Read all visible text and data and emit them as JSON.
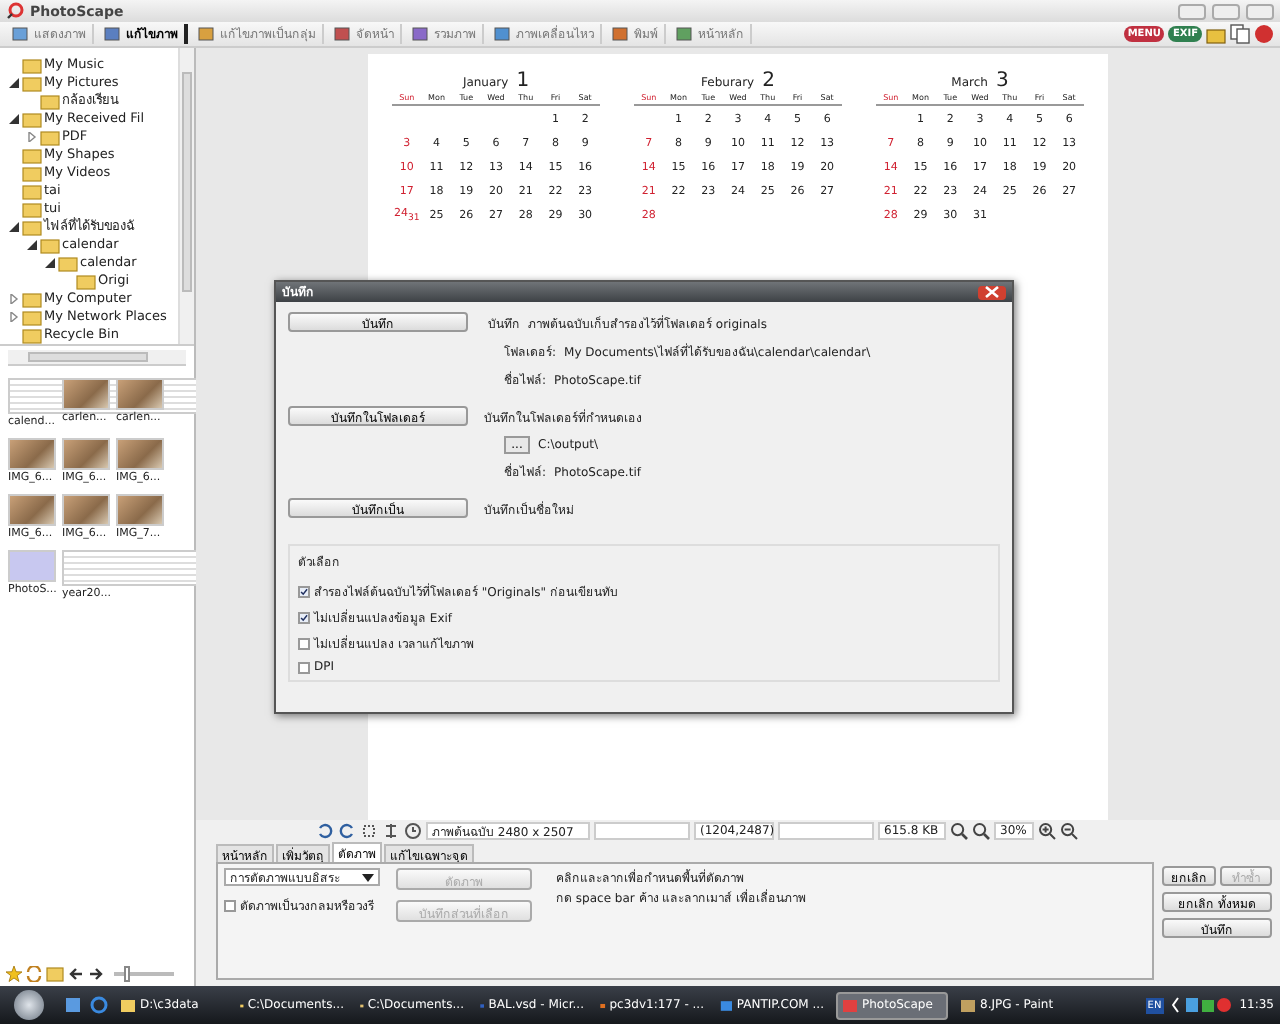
{
  "window": {
    "title": "PhotoScape"
  },
  "main_tabs": [
    {
      "label": "แสดงภาพ",
      "selected": false
    },
    {
      "label": "แก้ไขภาพ",
      "selected": true
    },
    {
      "label": "แก้ไขภาพเป็นกลุ่ม",
      "selected": false
    },
    {
      "label": "จัดหน้า",
      "selected": false
    },
    {
      "label": "รวมภาพ",
      "selected": false
    },
    {
      "label": "ภาพเคลื่อนไหว",
      "selected": false
    },
    {
      "label": "พิมพ์",
      "selected": false
    },
    {
      "label": "หน้าหลัก",
      "selected": false
    }
  ],
  "top_right": {
    "menu": "MENU",
    "exif": "EXIF"
  },
  "folder_tree": [
    {
      "label": "My Music"
    },
    {
      "label": "My Pictures",
      "expanded": true,
      "children": [
        {
          "label": "กล้องเรียน"
        }
      ]
    },
    {
      "label": "My Received Fil",
      "expanded": true,
      "children": [
        {
          "label": "PDF",
          "expanded": false
        }
      ]
    },
    {
      "label": "My Shapes"
    },
    {
      "label": "My Videos"
    },
    {
      "label": "tai"
    },
    {
      "label": "tui"
    },
    {
      "label": "ไฟล์ที่ได้รับของฉั",
      "expanded": true,
      "children": [
        {
          "label": "calendar",
          "expanded": true,
          "children": [
            {
              "label": "calendar",
              "expanded": true,
              "children": [
                {
                  "label": "Origi"
                }
              ]
            }
          ]
        }
      ]
    },
    {
      "label": "My Computer",
      "expanded": false
    },
    {
      "label": "My Network Places",
      "expanded": false
    },
    {
      "label": "Recycle Bin"
    }
  ],
  "thumbnail_slider": {
    "level": 0.2
  },
  "thumbnails": [
    {
      "name": "calend...",
      "kind": "page"
    },
    {
      "name": "carlen...",
      "kind": "photo"
    },
    {
      "name": "carlen...",
      "kind": "photo"
    },
    {
      "name": "IMG_6...",
      "kind": "photo"
    },
    {
      "name": "IMG_6...",
      "kind": "photo"
    },
    {
      "name": "IMG_6...",
      "kind": "photo"
    },
    {
      "name": "IMG_6...",
      "kind": "photo"
    },
    {
      "name": "IMG_6...",
      "kind": "photo"
    },
    {
      "name": "IMG_7...",
      "kind": "photo"
    },
    {
      "name": "PhotoS...",
      "kind": "blank"
    },
    {
      "name": "year20...",
      "kind": "page"
    }
  ],
  "calendar": {
    "months": [
      {
        "name": "January",
        "number": "1",
        "weekdays": [
          "Sun",
          "Mon",
          "Tue",
          "Wed",
          "Thu",
          "Fri",
          "Sat"
        ],
        "weeks": [
          {
            "kind": "first",
            "days": [
              "1",
              "2"
            ]
          },
          {
            "kind": "full",
            "days": [
              "3",
              "4",
              "5",
              "6",
              "7",
              "8",
              "9"
            ]
          },
          {
            "kind": "full",
            "days": [
              "10",
              "11",
              "12",
              "13",
              "14",
              "15",
              "16"
            ]
          },
          {
            "kind": "full",
            "days": [
              "17",
              "18",
              "19",
              "20",
              "21",
              "22",
              "23"
            ]
          },
          {
            "kind": "full",
            "days": [
              "24$_{31}$",
              "25",
              "26",
              "27",
              "28",
              "29",
              "30"
            ]
          }
        ]
      },
      {
        "name": "Feburary",
        "number": "2",
        "weekdays": [
          "Sun",
          "Mon",
          "Tue",
          "Wed",
          "Thu",
          "Fri",
          "Sat"
        ],
        "weeks": [
          {
            "kind": "first",
            "days": [
              "1",
              "2",
              "3",
              "4",
              "5",
              "6"
            ]
          },
          {
            "kind": "full",
            "days": [
              "7",
              "8",
              "9",
              "10",
              "11",
              "12",
              "13"
            ]
          },
          {
            "kind": "full",
            "days": [
              "14",
              "15",
              "16",
              "17",
              "18",
              "19",
              "20"
            ]
          },
          {
            "kind": "full",
            "days": [
              "21",
              "22",
              "23",
              "24",
              "25",
              "26",
              "27"
            ]
          },
          {
            "kind": "last",
            "days": [
              "28"
            ]
          }
        ]
      },
      {
        "name": "March",
        "number": "3",
        "weekdays": [
          "Sun",
          "Mon",
          "Tue",
          "Wed",
          "Thu",
          "Fri",
          "Sat"
        ],
        "weeks": [
          {
            "kind": "first",
            "days": [
              "1",
              "2",
              "3",
              "4",
              "5",
              "6"
            ]
          },
          {
            "kind": "full",
            "days": [
              "7",
              "8",
              "9",
              "10",
              "11",
              "12",
              "13"
            ]
          },
          {
            "kind": "full",
            "days": [
              "14",
              "15",
              "16",
              "17",
              "18",
              "19",
              "20"
            ]
          },
          {
            "kind": "full",
            "days": [
              "21",
              "22",
              "23",
              "24",
              "25",
              "26",
              "27"
            ]
          },
          {
            "kind": "last",
            "days": [
              "28",
              "29",
              "30",
              "31"
            ]
          }
        ]
      }
    ]
  },
  "dialog": {
    "title": "บันทึก",
    "sections": [
      {
        "button": "บันทึก",
        "lines": [
          {
            "label": "บันทึก",
            "value": "ภาพต้นฉบับเก็บสำรองไว้ที่โฟลเดอร์ originals"
          },
          {
            "label": "โฟลเดอร์:",
            "value": "My Documents\\ไฟล์ที่ได้รับของฉัน\\calendar\\calendar\\"
          },
          {
            "label": "ชื่อไฟล์:",
            "value": "PhotoScape.tif"
          }
        ]
      },
      {
        "button": "บันทึกในโฟลเดอร์",
        "description": "บันทึกในโฟลเดอร์ที่กำหนดเอง",
        "browse": "...",
        "path": "C:\\output\\",
        "lines": [
          {
            "label": "ชื่อไฟล์:",
            "value": "PhotoScape.tif"
          }
        ]
      },
      {
        "button": "บันทึกเป็น",
        "description": "บันทึกเป็นชื่อใหม่"
      }
    ],
    "options_title": "ตัวเลือก",
    "options": [
      {
        "label": "สำรองไฟล์ต้นฉบับไว้ที่โฟลเดอร์ \"Originals\" ก่อนเขียนทับ",
        "checked": true
      },
      {
        "label": "ไม่เปลี่ยนแปลงข้อมูล Exif",
        "checked": true
      },
      {
        "label": "ไม่เปลี่ยนแปลง เวลาแก้ไขภาพ",
        "checked": false
      },
      {
        "label": "DPI",
        "checked": false
      }
    ]
  },
  "status_bar": {
    "size": "ภาพต้นฉบับ 2480 x 2507",
    "position": "(1204,2487)",
    "file_size": "615.8 KB",
    "zoom": "30%"
  },
  "edit_tabs": [
    {
      "label": "หน้าหลัก",
      "selected": false
    },
    {
      "label": "เพิ่มวัตถุ",
      "selected": false
    },
    {
      "label": "ตัดภาพ",
      "selected": true
    },
    {
      "label": "แก้ไขเฉพาะจุด",
      "selected": false
    }
  ],
  "crop_panel": {
    "mode": "การตัดภาพแบบอิสระ",
    "crop_button": {
      "label": "ตัดภาพ",
      "disabled": true
    },
    "circle_option": {
      "label": "ตัดภาพเป็นวงกลมหรือวงรี",
      "checked": false
    },
    "save_selection_button": {
      "label": "บันทึกส่วนที่เลือก",
      "disabled": true
    },
    "hint": [
      "คลิกและลากเพื่อกำหนดพื้นที่ตัดภาพ",
      "กด space bar ค้าง และลากเมาส์ เพื่อเลื่อนภาพ"
    ]
  },
  "side_buttons": [
    {
      "label": "ยกเลิก",
      "disabled": false
    },
    {
      "label": "ทำซ้ำ",
      "disabled": true
    },
    {
      "label": "ยกเลิก ทั้งหมด",
      "disabled": false
    },
    {
      "label": "บันทึก",
      "disabled": false
    }
  ],
  "taskbar": {
    "items": [
      {
        "label": "D:\\c3data",
        "selected": false
      },
      {
        "label": "C:\\Documents...",
        "selected": false
      },
      {
        "label": "C:\\Documents...",
        "selected": false
      },
      {
        "label": "BAL.vsd - Micr...",
        "selected": false
      },
      {
        "label": "pc3dv1:177 - ...",
        "selected": false
      },
      {
        "label": "PANTIP.COM ...",
        "selected": false
      },
      {
        "label": "PhotoScape",
        "selected": true
      },
      {
        "label": "8.JPG - Paint",
        "selected": false
      }
    ],
    "language": "EN",
    "time": "11:35"
  }
}
